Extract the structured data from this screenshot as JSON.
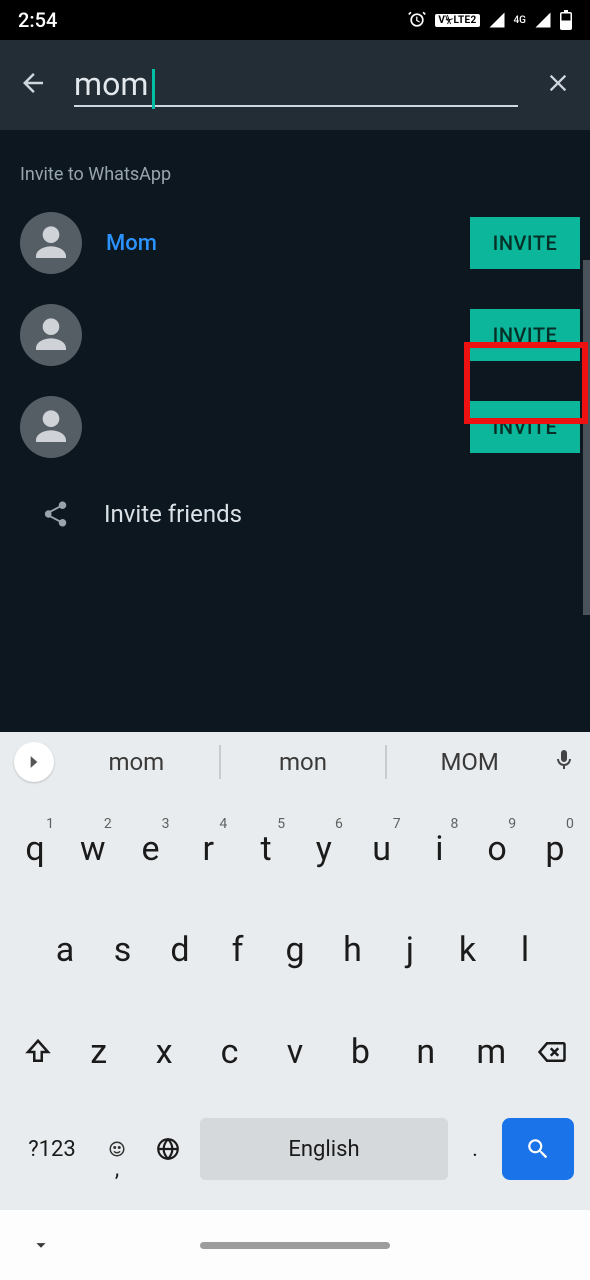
{
  "status": {
    "time": "2:54",
    "volte": "V⏧LTE2",
    "net": "4G"
  },
  "search": {
    "value": "mom"
  },
  "section_title": "Invite to WhatsApp",
  "contacts": [
    {
      "name": "Mom",
      "invite": "INVITE"
    },
    {
      "name": "",
      "invite": "INVITE"
    },
    {
      "name": "",
      "invite": "INVITE"
    }
  ],
  "invite_friends": "Invite friends",
  "keyboard": {
    "suggestions": [
      "mom",
      "mon",
      "MOM"
    ],
    "row1": [
      {
        "k": "q",
        "n": "1"
      },
      {
        "k": "w",
        "n": "2"
      },
      {
        "k": "e",
        "n": "3"
      },
      {
        "k": "r",
        "n": "4"
      },
      {
        "k": "t",
        "n": "5"
      },
      {
        "k": "y",
        "n": "6"
      },
      {
        "k": "u",
        "n": "7"
      },
      {
        "k": "i",
        "n": "8"
      },
      {
        "k": "o",
        "n": "9"
      },
      {
        "k": "p",
        "n": "0"
      }
    ],
    "row2": [
      "a",
      "s",
      "d",
      "f",
      "g",
      "h",
      "j",
      "k",
      "l"
    ],
    "row3": [
      "z",
      "x",
      "c",
      "v",
      "b",
      "n",
      "m"
    ],
    "sym": "?123",
    "space": "English"
  }
}
